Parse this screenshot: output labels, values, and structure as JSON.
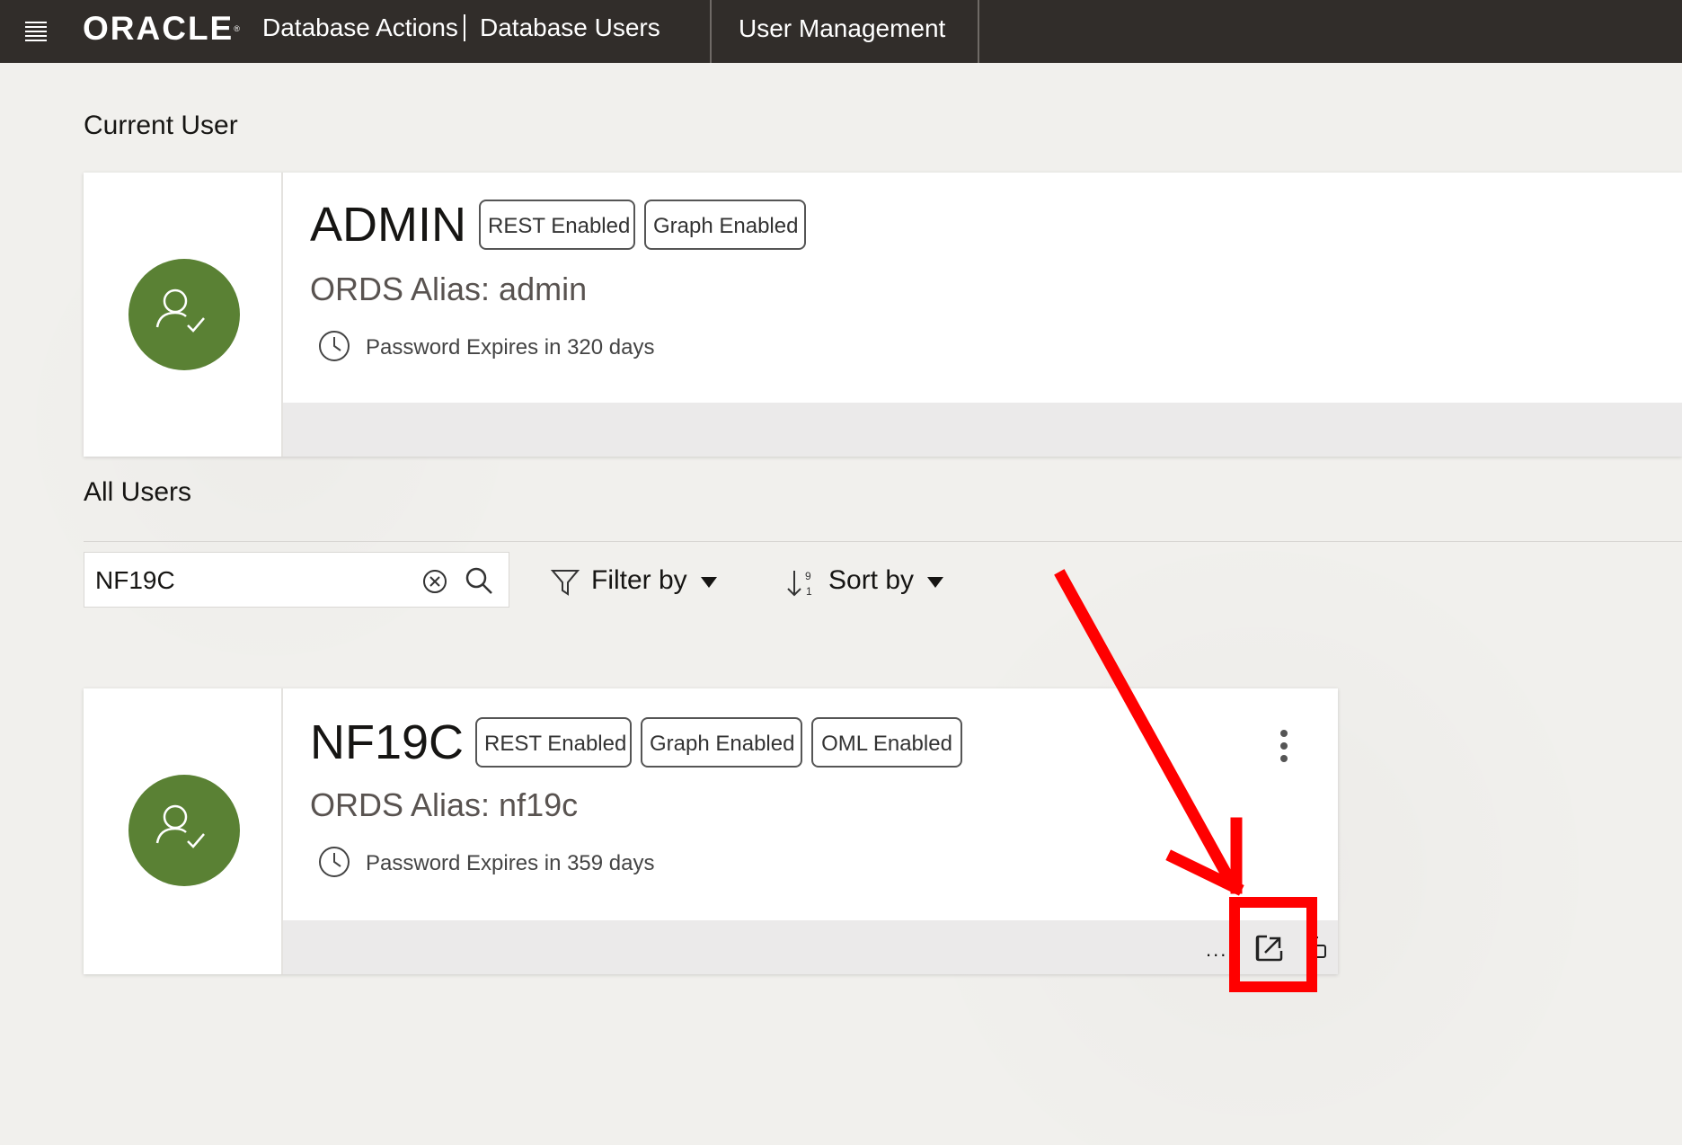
{
  "header": {
    "brand": "ORACLE",
    "app_title": "Database Actions",
    "page_title": "Database Users",
    "nav_tab": "User Management"
  },
  "current_user_section": {
    "title": "Current User",
    "user": {
      "name": "ADMIN",
      "badges": [
        "REST Enabled",
        "Graph Enabled"
      ],
      "alias": "ORDS Alias: admin",
      "password_expiry": "Password Expires in 320 days"
    }
  },
  "all_users_section": {
    "title": "All Users",
    "search": {
      "value": "NF19C",
      "placeholder": ""
    },
    "filter_label": "Filter by",
    "sort_label": "Sort by",
    "users": [
      {
        "name": "NF19C",
        "badges": [
          "REST Enabled",
          "Graph Enabled",
          "OML Enabled"
        ],
        "alias": "ORDS Alias: nf19c",
        "password_expiry": "Password Expires in 359 days",
        "footer_more": "..."
      }
    ]
  },
  "colors": {
    "topbar": "#312d2a",
    "avatar": "#5a8134",
    "annotation": "#ff0000"
  },
  "icons": {
    "menu": "hamburger-menu-icon",
    "avatar": "user-check-icon",
    "clock": "clock-icon",
    "clear": "clear-circle-icon",
    "search": "search-icon",
    "filter": "filter-funnel-icon",
    "sort": "sort-icon",
    "kebab": "kebab-menu-icon",
    "open": "open-external-icon",
    "lock": "lock-icon",
    "annotation_arrow": "arrow-annotation"
  }
}
